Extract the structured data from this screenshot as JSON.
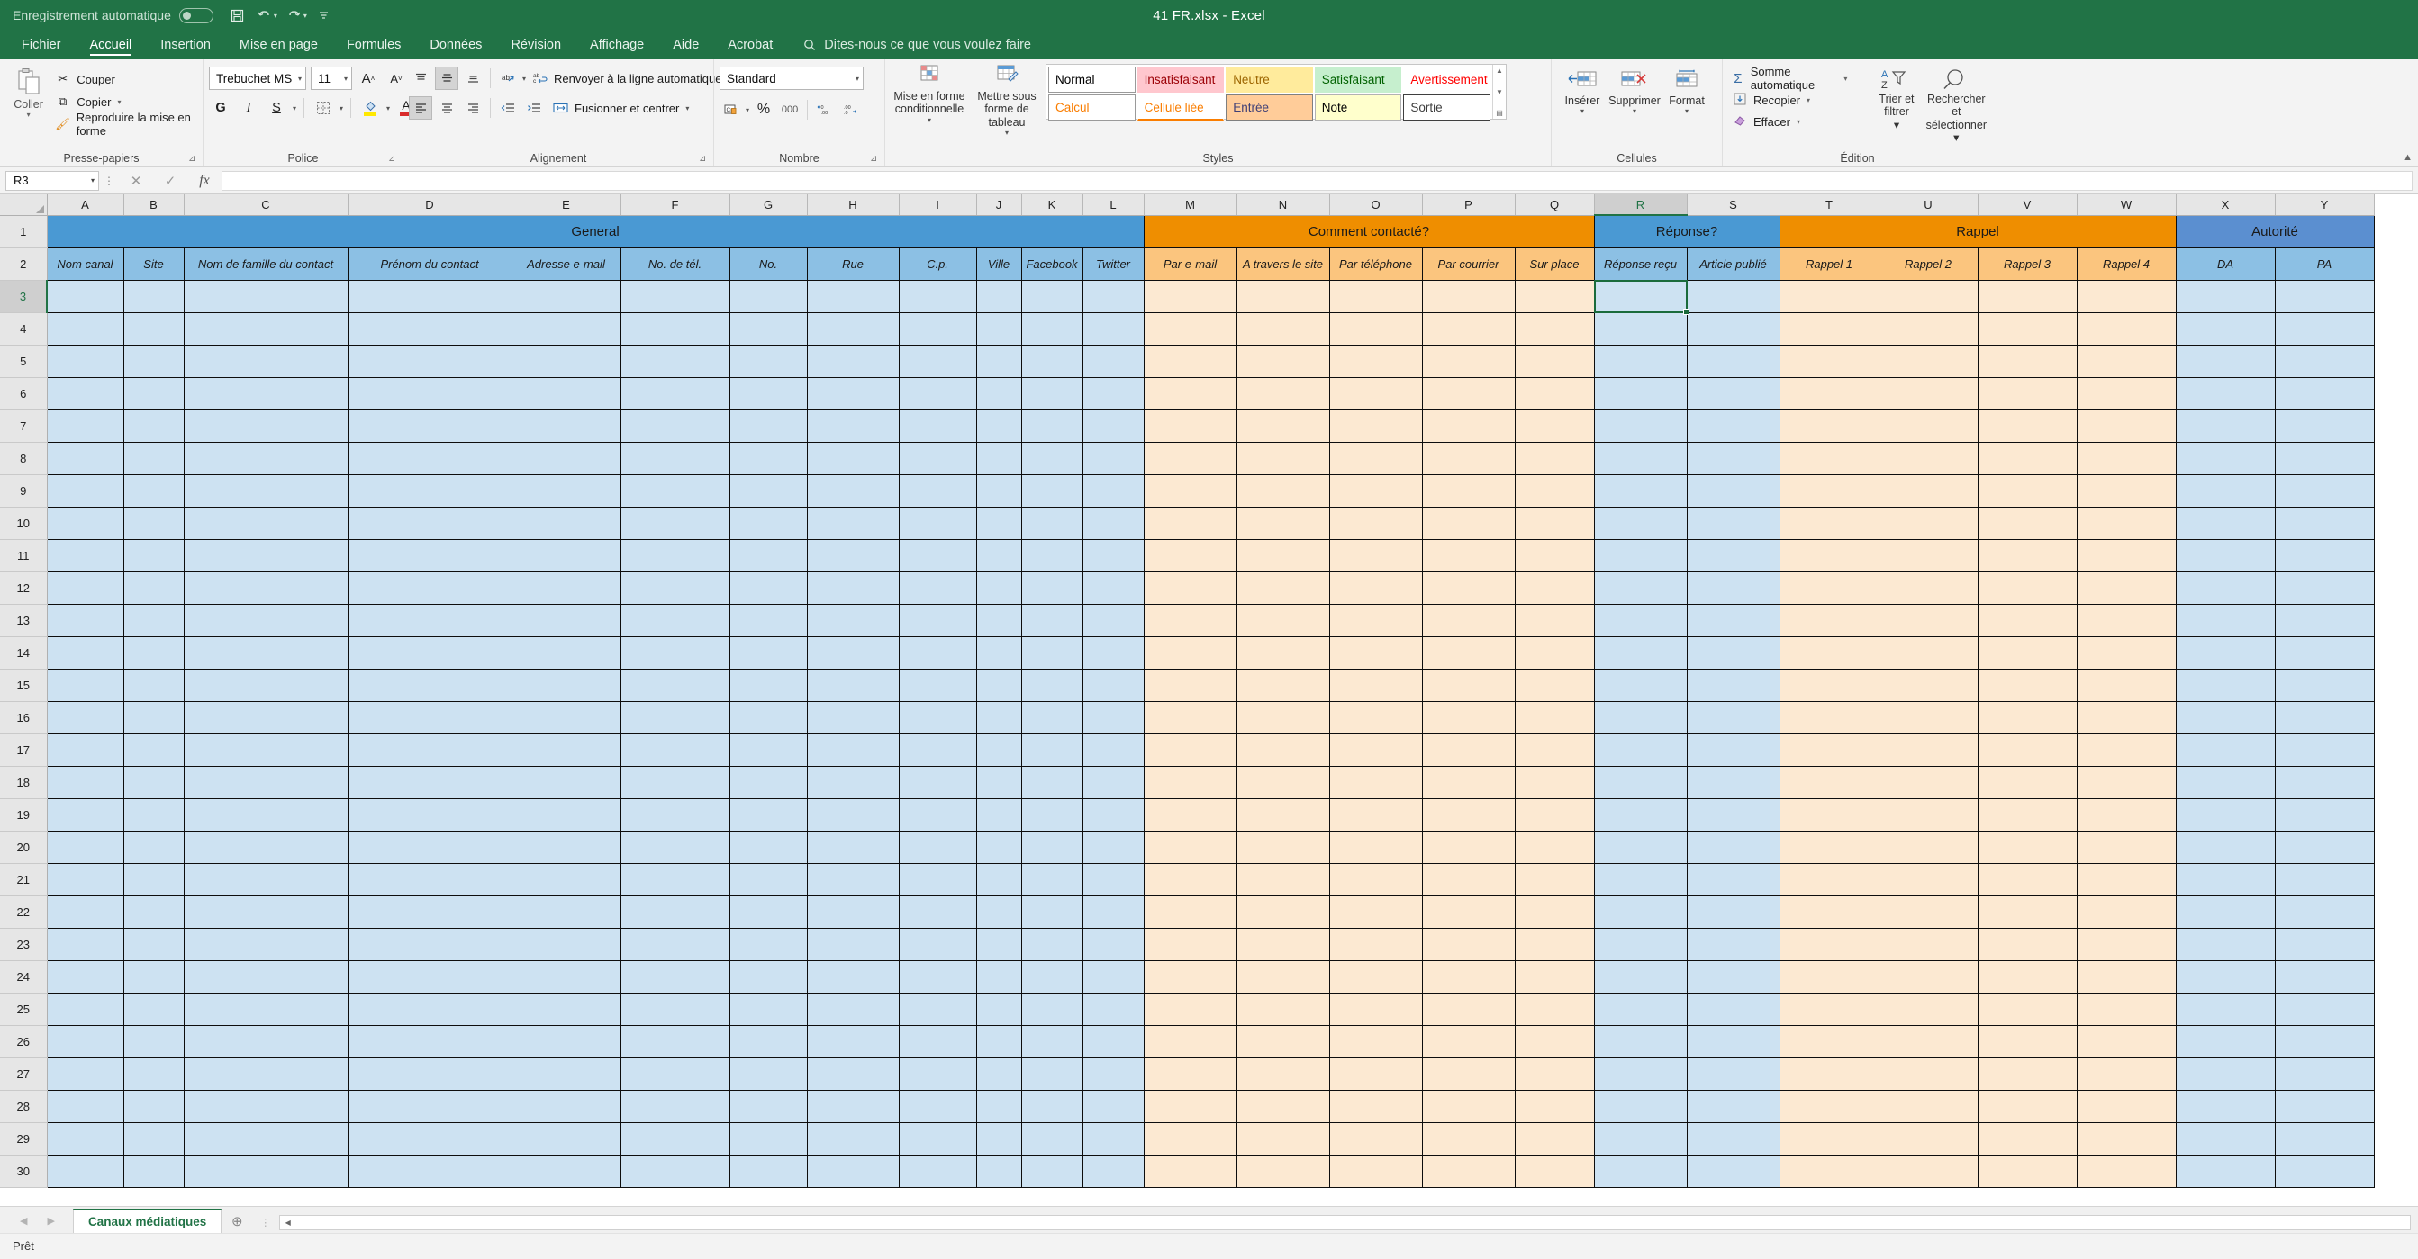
{
  "titlebar": {
    "autosave_label": "Enregistrement automatique",
    "autosave_state": "Off",
    "save_icon": "save-icon",
    "undo_icon": "undo-icon",
    "redo_icon": "redo-icon",
    "customize_icon": "customize-quick-access-icon",
    "document_title": "41 FR.xlsx  -  Excel"
  },
  "tabs": [
    {
      "label": "Fichier",
      "active": false
    },
    {
      "label": "Accueil",
      "active": true
    },
    {
      "label": "Insertion",
      "active": false
    },
    {
      "label": "Mise en page",
      "active": false
    },
    {
      "label": "Formules",
      "active": false
    },
    {
      "label": "Données",
      "active": false
    },
    {
      "label": "Révision",
      "active": false
    },
    {
      "label": "Affichage",
      "active": false
    },
    {
      "label": "Aide",
      "active": false
    },
    {
      "label": "Acrobat",
      "active": false
    }
  ],
  "tell_me": "Dites-nous ce que vous voulez faire",
  "ribbon": {
    "clipboard": {
      "group_label": "Presse-papiers",
      "paste_label": "Coller",
      "cut_label": "Couper",
      "copy_label": "Copier",
      "format_painter_label": "Reproduire la mise en forme"
    },
    "font": {
      "group_label": "Police",
      "font_name": "Trebuchet MS",
      "font_size": "11",
      "bold_label": "G",
      "italic_label": "I",
      "underline_label": "S",
      "grow_label": "A",
      "shrink_label": "A",
      "highlight_color": "#ffe800",
      "font_color": "#d92b2b"
    },
    "alignment": {
      "group_label": "Alignement",
      "wrap_text_label": "Renvoyer à la ligne automatiquement",
      "merge_label": "Fusionner et centrer"
    },
    "number": {
      "group_label": "Nombre",
      "format_value": "Standard",
      "percent_label": "%",
      "thousands_label": "000"
    },
    "styles": {
      "group_label": "Styles",
      "conditional_label": "Mise en forme conditionnelle",
      "table_label": "Mettre sous forme de tableau",
      "gallery": [
        {
          "name": "Normal",
          "bg": "#ffffff",
          "fg": "#000000",
          "border": "#9a9a9a"
        },
        {
          "name": "Insatisfaisant",
          "bg": "#ffc7ce",
          "fg": "#9c0006",
          "border": "transparent"
        },
        {
          "name": "Neutre",
          "bg": "#ffeb9c",
          "fg": "#9c6500",
          "border": "transparent"
        },
        {
          "name": "Satisfaisant",
          "bg": "#c6efce",
          "fg": "#006100",
          "border": "transparent"
        },
        {
          "name": "Avertissement",
          "bg": "#ffffff",
          "fg": "#ff0000",
          "border": "transparent"
        },
        {
          "name": "Calcul",
          "bg": "#ffffff",
          "fg": "#fa7d00",
          "border": "#9a9a9a"
        },
        {
          "name": "Cellule liée",
          "bg": "#ffffff",
          "fg": "#fa7d00",
          "border": "transparent"
        },
        {
          "name": "Entrée",
          "bg": "#ffcc99",
          "fg": "#3f3f76",
          "border": "#7f7f7f"
        },
        {
          "name": "Note",
          "bg": "#ffffcc",
          "fg": "#000000",
          "border": "#b2b2b2"
        },
        {
          "name": "Sortie",
          "bg": "#ffffff",
          "fg": "#3f3f3f",
          "border": "#3f3f3f"
        }
      ]
    },
    "cells": {
      "group_label": "Cellules",
      "insert_label": "Insérer",
      "delete_label": "Supprimer",
      "format_label": "Format"
    },
    "editing": {
      "group_label": "Édition",
      "autosum_label": "Somme automatique",
      "fill_label": "Recopier",
      "clear_label": "Effacer",
      "sort_filter_label": "Trier et filtrer",
      "find_select_label": "Rechercher et sélectionner"
    }
  },
  "formula_bar": {
    "name_box": "R3",
    "cancel_icon": "cancel-icon",
    "confirm_icon": "confirm-icon",
    "function_icon": "fx-icon",
    "formula_value": ""
  },
  "grid": {
    "columns": [
      {
        "letter": "A",
        "width": 85
      },
      {
        "letter": "B",
        "width": 67
      },
      {
        "letter": "C",
        "width": 182
      },
      {
        "letter": "D",
        "width": 182
      },
      {
        "letter": "E",
        "width": 121
      },
      {
        "letter": "F",
        "width": 121
      },
      {
        "letter": "G",
        "width": 86
      },
      {
        "letter": "H",
        "width": 102
      },
      {
        "letter": "I",
        "width": 86
      },
      {
        "letter": "J",
        "width": 50
      },
      {
        "letter": "K",
        "width": 68
      },
      {
        "letter": "L",
        "width": 68
      },
      {
        "letter": "M",
        "width": 103
      },
      {
        "letter": "N",
        "width": 103
      },
      {
        "letter": "O",
        "width": 103
      },
      {
        "letter": "P",
        "width": 103
      },
      {
        "letter": "Q",
        "width": 88
      },
      {
        "letter": "R",
        "width": 103
      },
      {
        "letter": "S",
        "width": 103
      },
      {
        "letter": "T",
        "width": 110
      },
      {
        "letter": "U",
        "width": 110
      },
      {
        "letter": "V",
        "width": 110
      },
      {
        "letter": "W",
        "width": 110
      },
      {
        "letter": "X",
        "width": 110
      },
      {
        "letter": "Y",
        "width": 110
      }
    ],
    "selected_column": "R",
    "selected_row": 3,
    "selected_cell": "R3",
    "row_count": 30,
    "banners": [
      {
        "label": "General",
        "span": 12,
        "color": "#4a99d3"
      },
      {
        "label": "Comment contacté?",
        "span": 5,
        "color": "#ef8e00"
      },
      {
        "label": "Réponse?",
        "span": 2,
        "color": "#4a99d3"
      },
      {
        "label": "Rappel",
        "span": 4,
        "color": "#ef8e00"
      },
      {
        "label": "Autorité",
        "span": 2,
        "color": "#5b8fd0"
      }
    ],
    "headers": [
      {
        "label": "Nom canal",
        "tone": "blue"
      },
      {
        "label": "Site",
        "tone": "blue"
      },
      {
        "label": "Nom de famille du contact",
        "tone": "blue"
      },
      {
        "label": "Prénom du contact",
        "tone": "blue"
      },
      {
        "label": "Adresse e-mail",
        "tone": "blue"
      },
      {
        "label": "No. de tél.",
        "tone": "blue"
      },
      {
        "label": "No.",
        "tone": "blue"
      },
      {
        "label": "Rue",
        "tone": "blue"
      },
      {
        "label": "C.p.",
        "tone": "blue"
      },
      {
        "label": "Ville",
        "tone": "blue"
      },
      {
        "label": "Facebook",
        "tone": "blue"
      },
      {
        "label": "Twitter",
        "tone": "blue"
      },
      {
        "label": "Par e-mail",
        "tone": "orange"
      },
      {
        "label": "A travers le site",
        "tone": "orange"
      },
      {
        "label": "Par téléphone",
        "tone": "orange"
      },
      {
        "label": "Par courrier",
        "tone": "orange"
      },
      {
        "label": "Sur place",
        "tone": "orange"
      },
      {
        "label": "Réponse reçu",
        "tone": "blue"
      },
      {
        "label": "Article publié",
        "tone": "blue"
      },
      {
        "label": "Rappel 1",
        "tone": "orange"
      },
      {
        "label": "Rappel 2",
        "tone": "orange"
      },
      {
        "label": "Rappel 3",
        "tone": "orange"
      },
      {
        "label": "Rappel 4",
        "tone": "orange"
      },
      {
        "label": "DA",
        "tone": "blue"
      },
      {
        "label": "PA",
        "tone": "blue"
      }
    ],
    "body_tones": [
      "blue",
      "blue",
      "blue",
      "blue",
      "blue",
      "blue",
      "blue",
      "blue",
      "blue",
      "blue",
      "blue",
      "blue",
      "peach",
      "peach",
      "peach",
      "peach",
      "peach",
      "blue",
      "blue",
      "peach",
      "peach",
      "peach",
      "peach",
      "blue",
      "blue"
    ]
  },
  "sheet_tabs": {
    "prev_icon": "previous-sheet-icon",
    "next_icon": "next-sheet-icon",
    "active_sheet": "Canaux médiatiques",
    "add_sheet_label": "+"
  },
  "status_bar": {
    "status": "Prêt"
  }
}
